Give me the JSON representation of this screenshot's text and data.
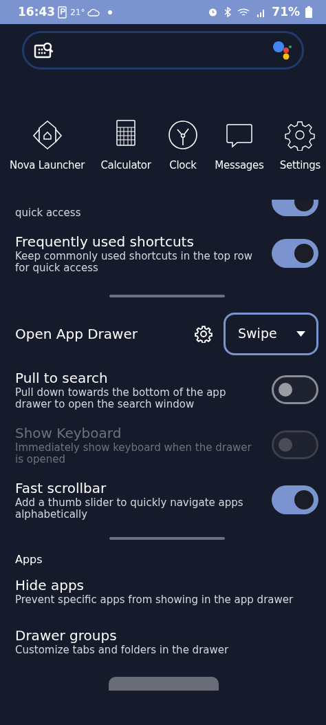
{
  "status_bar": {
    "time": "16:43",
    "temperature": "21°",
    "battery": "71%"
  },
  "apps": [
    {
      "kind": "nova",
      "label": "Nova Launcher"
    },
    {
      "kind": "calculator",
      "label": "Calculator"
    },
    {
      "kind": "clock",
      "label": "Clock"
    },
    {
      "kind": "messages",
      "label": "Messages"
    },
    {
      "kind": "settings",
      "label": "Settings"
    }
  ],
  "settings": [
    {
      "kind": "partial",
      "description": "quick access",
      "on": true
    },
    {
      "kind": "toggle",
      "title": "Frequently used shortcuts",
      "description": "Keep commonly used shortcuts in the top row for quick access",
      "on": true,
      "disabled": false
    },
    {
      "kind": "divider"
    },
    {
      "kind": "dropdown",
      "title": "Open App Drawer",
      "value": "Swipe"
    },
    {
      "kind": "toggle",
      "title": "Pull to search",
      "description": "Pull down towards the bottom of the app drawer to open the search window",
      "on": false,
      "disabled": false
    },
    {
      "kind": "toggle",
      "title": "Show Keyboard",
      "description": "Immediately show keyboard when the drawer is opened",
      "on": false,
      "disabled": true
    },
    {
      "kind": "toggle",
      "title": "Fast scrollbar",
      "description": "Add a thumb slider to quickly navigate apps alphabetically",
      "on": true,
      "disabled": false
    },
    {
      "kind": "divider"
    },
    {
      "kind": "header",
      "title": "Apps"
    },
    {
      "kind": "link",
      "title": "Hide apps",
      "description": "Prevent specific apps from showing in the app drawer"
    },
    {
      "kind": "link",
      "title": "Drawer groups",
      "description": "Customize tabs and folders in the drawer"
    },
    {
      "kind": "pill"
    }
  ]
}
